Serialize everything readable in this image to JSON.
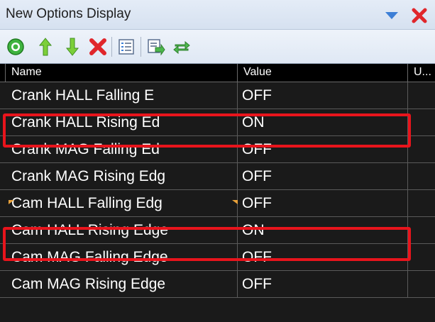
{
  "window": {
    "title": "New Options Display"
  },
  "toolbar": {
    "buttons": [
      {
        "icon": "add-icon"
      },
      {
        "icon": "move-up-icon"
      },
      {
        "icon": "move-down-icon"
      },
      {
        "icon": "delete-icon"
      },
      {
        "icon": "properties-icon"
      },
      {
        "icon": "export-icon"
      },
      {
        "icon": "refresh-icon"
      }
    ]
  },
  "table": {
    "columns": [
      "Name",
      "Value",
      "U..."
    ],
    "rows": [
      {
        "name": "Crank HALL Falling E",
        "value": "OFF",
        "unit": ""
      },
      {
        "name": "Crank HALL Rising Ed",
        "value": "ON",
        "unit": ""
      },
      {
        "name": "Crank MAG Falling Ed",
        "value": "OFF",
        "unit": ""
      },
      {
        "name": "Crank MAG Rising Edg",
        "value": "OFF",
        "unit": ""
      },
      {
        "name": "Cam HALL Falling Edg",
        "value": "OFF",
        "unit": ""
      },
      {
        "name": "Cam HALL Rising Edge",
        "value": "ON",
        "unit": ""
      },
      {
        "name": "Cam MAG Falling Edge",
        "value": "OFF",
        "unit": ""
      },
      {
        "name": "Cam MAG Rising Edge",
        "value": "OFF",
        "unit": ""
      }
    ]
  },
  "colors": {
    "highlight": "#e8141c",
    "grid_background": "#1a1a1a",
    "titlebar": "#dce6f3"
  }
}
